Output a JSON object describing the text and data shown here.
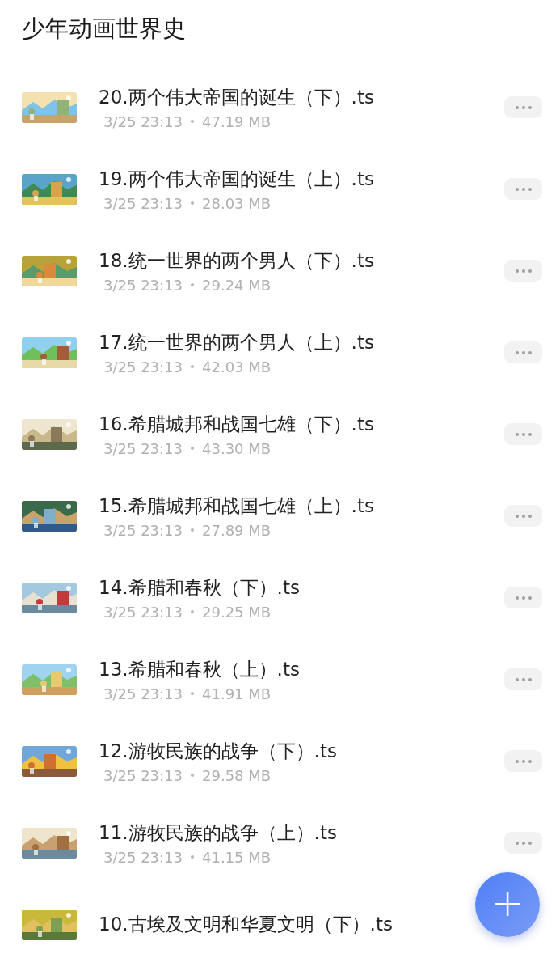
{
  "title": "少年动画世界史",
  "files": [
    {
      "name": "20.两个伟大帝国的诞生（下）.ts",
      "date": "3/25 23:13",
      "size": "47.19 MB"
    },
    {
      "name": "19.两个伟大帝国的诞生（上）.ts",
      "date": "3/25 23:13",
      "size": "28.03 MB"
    },
    {
      "name": "18.统一世界的两个男人（下）.ts",
      "date": "3/25 23:13",
      "size": "29.24 MB"
    },
    {
      "name": "17.统一世界的两个男人（上）.ts",
      "date": "3/25 23:13",
      "size": "42.03 MB"
    },
    {
      "name": "16.希腊城邦和战国七雄（下）.ts",
      "date": "3/25 23:13",
      "size": "43.30 MB"
    },
    {
      "name": "15.希腊城邦和战国七雄（上）.ts",
      "date": "3/25 23:13",
      "size": "27.89 MB"
    },
    {
      "name": "14.希腊和春秋（下）.ts",
      "date": "3/25 23:13",
      "size": "29.25 MB"
    },
    {
      "name": "13.希腊和春秋（上）.ts",
      "date": "3/25 23:13",
      "size": "41.91 MB"
    },
    {
      "name": "12.游牧民族的战争（下）.ts",
      "date": "3/25 23:13",
      "size": "29.58 MB"
    },
    {
      "name": "11.游牧民族的战争（上）.ts",
      "date": "3/25 23:13",
      "size": "41.15 MB"
    },
    {
      "name": "10.古埃及文明和华夏文明（下）.ts"
    }
  ],
  "fab": {
    "label": "+"
  }
}
